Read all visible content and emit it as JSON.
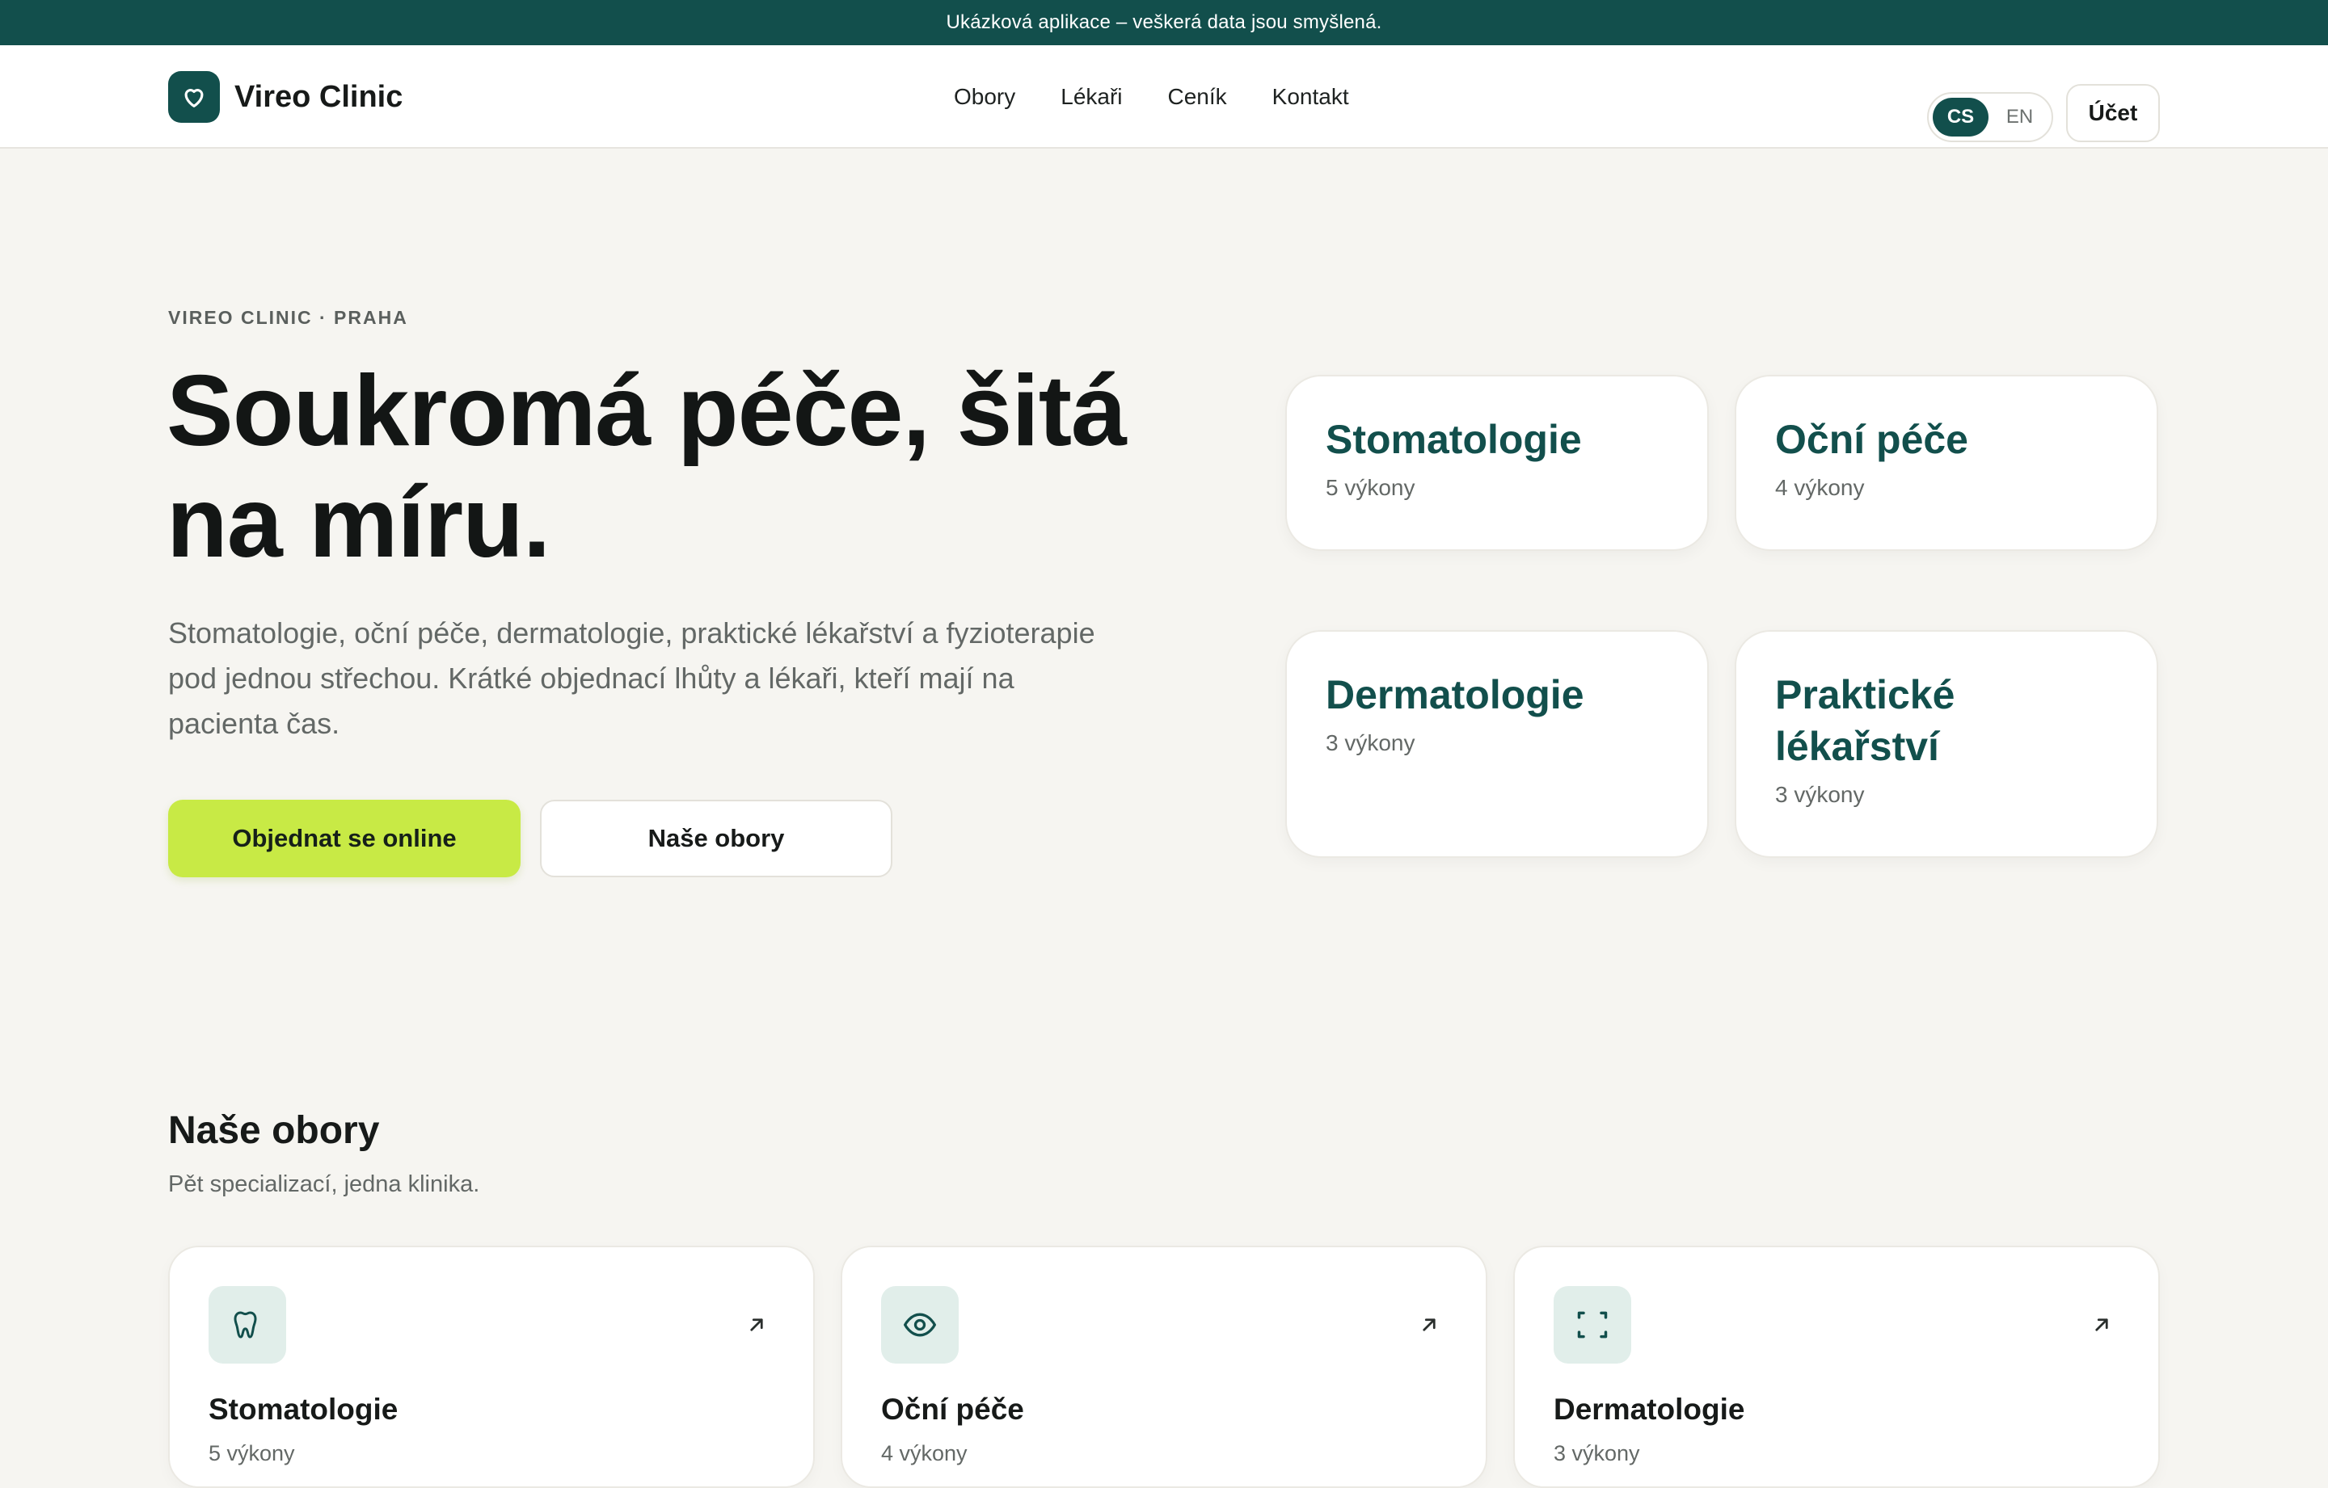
{
  "announcement": "Ukázková aplikace – veškerá data jsou smyšlená.",
  "brand": {
    "name": "Vireo Clinic",
    "logo_icon": "heart-icon"
  },
  "nav": [
    {
      "label": "Obory"
    },
    {
      "label": "Lékaři"
    },
    {
      "label": "Ceník"
    },
    {
      "label": "Kontakt"
    }
  ],
  "language": {
    "active": "CS",
    "other": "EN"
  },
  "account_label": "Účet",
  "hero": {
    "eyebrow": "VIREO CLINIC · PRAHA",
    "title_line1": "Soukromá péče, šitá",
    "title_line2": "na míru.",
    "description": "Stomatologie, oční péče, dermatologie, praktické lékařství a fyzioterapie pod jednou střechou. Krátké objednací lhůty a lékaři, kteří mají na pacienta čas.",
    "primary_cta": "Objednat se online",
    "secondary_cta": "Naše obory"
  },
  "hero_cards": [
    {
      "title": "Stomatologie",
      "count": "5 výkony"
    },
    {
      "title": "Oční péče",
      "count": "4 výkony"
    },
    {
      "title": "Dermatologie",
      "count": "3 výkony"
    },
    {
      "title": "Praktické lékařství",
      "count": "3 výkony"
    }
  ],
  "section": {
    "title": "Naše obory",
    "subtitle": "Pět specializací, jedna klinika."
  },
  "obory": [
    {
      "title": "Stomatologie",
      "count": "5 výkony",
      "icon": "tooth-icon"
    },
    {
      "title": "Oční péče",
      "count": "4 výkony",
      "icon": "eye-icon"
    },
    {
      "title": "Dermatologie",
      "count": "3 výkony",
      "icon": "scan-icon"
    }
  ],
  "colors": {
    "brand": "#124f4c",
    "accent": "#c8ea45",
    "background": "#f6f5f1"
  }
}
